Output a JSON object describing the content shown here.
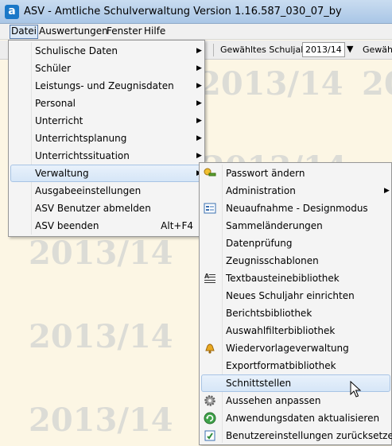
{
  "window": {
    "title": "ASV - Amtliche Schulverwaltung Version 1.16.587_030_07_by",
    "app_icon_letter": "a"
  },
  "menubar": [
    "Datei",
    "Auswertungen",
    "Fenster",
    "Hilfe"
  ],
  "toolbar": {
    "schuljahr_label": "Gewähltes Schuljahr",
    "schuljahr_value": "2013/14",
    "second_label": "Gewählt"
  },
  "watermark": "2013/14",
  "datei_menu": {
    "items": [
      {
        "label": "Schulische Daten",
        "submenu": true
      },
      {
        "label": "Schüler",
        "submenu": true
      },
      {
        "label": "Leistungs- und Zeugnisdaten",
        "submenu": true
      },
      {
        "label": "Personal",
        "submenu": true
      },
      {
        "label": "Unterricht",
        "submenu": true
      },
      {
        "label": "Unterrichtsplanung",
        "submenu": true
      },
      {
        "label": "Unterrichtssituation",
        "submenu": true
      },
      {
        "label": "Verwaltung",
        "submenu": true,
        "highlighted": true
      },
      {
        "label": "Ausgabeeinstellungen",
        "submenu": false
      },
      {
        "label": "ASV Benutzer abmelden",
        "submenu": false
      },
      {
        "label": "ASV beenden",
        "submenu": false,
        "shortcut": "Alt+F4"
      }
    ]
  },
  "verwaltung_menu": {
    "items": [
      {
        "label": "Passwort ändern",
        "icon": "key-icon"
      },
      {
        "label": "Administration",
        "submenu": true
      },
      {
        "label": "Neuaufnahme - Designmodus",
        "icon": "form-icon"
      },
      {
        "label": "Sammeländerungen"
      },
      {
        "label": "Datenprüfung"
      },
      {
        "label": "Zeugnisschablonen"
      },
      {
        "label": "Textbausteinebibliothek",
        "icon": "text-icon"
      },
      {
        "label": "Neues Schuljahr einrichten"
      },
      {
        "label": "Berichtsbibliothek"
      },
      {
        "label": "Auswahlfilterbibliothek"
      },
      {
        "label": "Wiedervorlageverwaltung",
        "icon": "bell-icon"
      },
      {
        "label": "Exportformatbibliothek"
      },
      {
        "label": "Schnittstellen",
        "highlighted": true
      },
      {
        "label": "Aussehen anpassen",
        "icon": "gear-icon"
      },
      {
        "label": "Anwendungsdaten aktualisieren",
        "icon": "refresh-icon"
      },
      {
        "label": "Benutzereinstellungen zurücksetzen",
        "icon": "reset-icon"
      }
    ]
  }
}
